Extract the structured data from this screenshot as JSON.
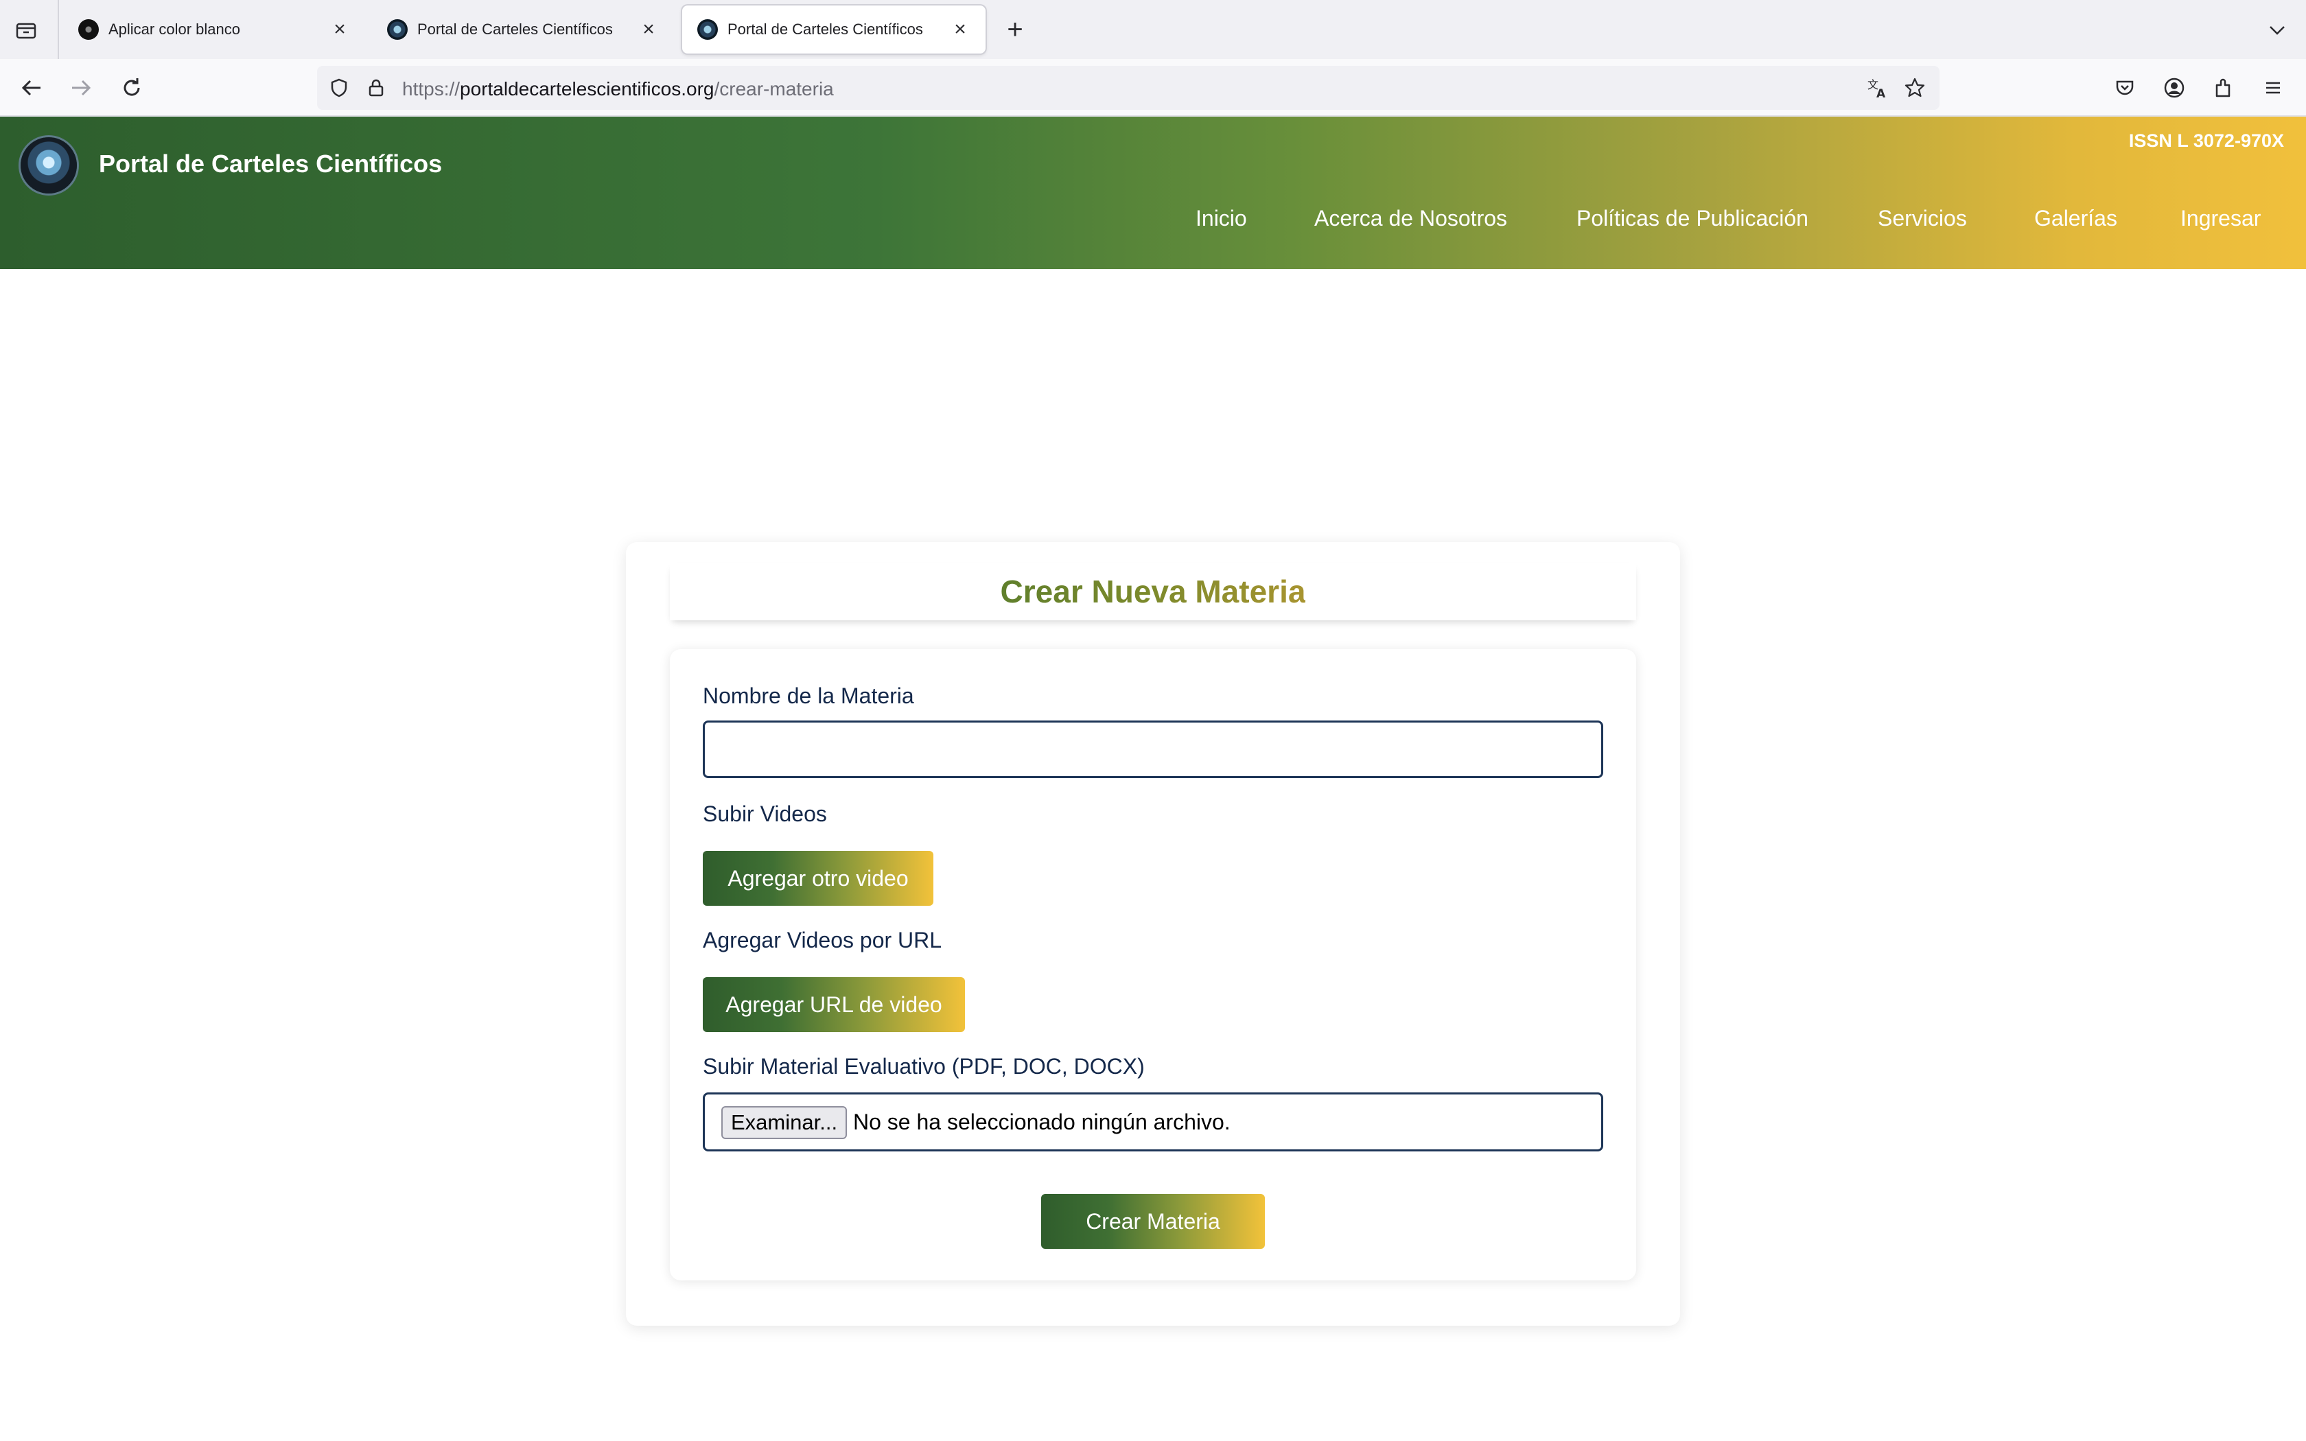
{
  "browser": {
    "tabs": [
      {
        "title": "Aplicar color blanco",
        "active": false
      },
      {
        "title": "Portal de Carteles Científicos",
        "active": false
      },
      {
        "title": "Portal de Carteles Científicos",
        "active": true
      }
    ],
    "url": {
      "scheme": "https://",
      "domain": "portaldecartelescientificos.org",
      "path": "/crear-materia"
    }
  },
  "site": {
    "name": "Portal de Carteles Científicos",
    "issn": "ISSN L 3072-970X",
    "nav": [
      "Inicio",
      "Acerca de Nosotros",
      "Políticas de Publicación",
      "Servicios",
      "Galerías",
      "Ingresar"
    ]
  },
  "form": {
    "title": "Crear Nueva Materia",
    "name_label": "Nombre de la Materia",
    "name_value": "",
    "videos_label": "Subir Videos",
    "add_video_button": "Agregar otro video",
    "url_label": "Agregar Videos por URL",
    "add_url_button": "Agregar URL de video",
    "material_label": "Subir Material Evaluativo (PDF, DOC, DOCX)",
    "browse_button": "Examinar...",
    "file_status": "No se ha seleccionado ningún archivo.",
    "submit_button": "Crear Materia"
  },
  "colors": {
    "header_gradient_start": "#2d5e2d",
    "header_gradient_end": "#f1c03c",
    "label_text": "#14284a",
    "input_border": "#1d3557"
  },
  "icons": [
    "tab-list-icon",
    "close-icon",
    "plus-icon",
    "chevron-down-icon",
    "back-arrow-icon",
    "forward-arrow-icon",
    "reload-icon",
    "shield-icon",
    "lock-icon",
    "translate-icon",
    "star-icon",
    "pocket-icon",
    "account-icon",
    "extensions-icon",
    "menu-icon"
  ]
}
